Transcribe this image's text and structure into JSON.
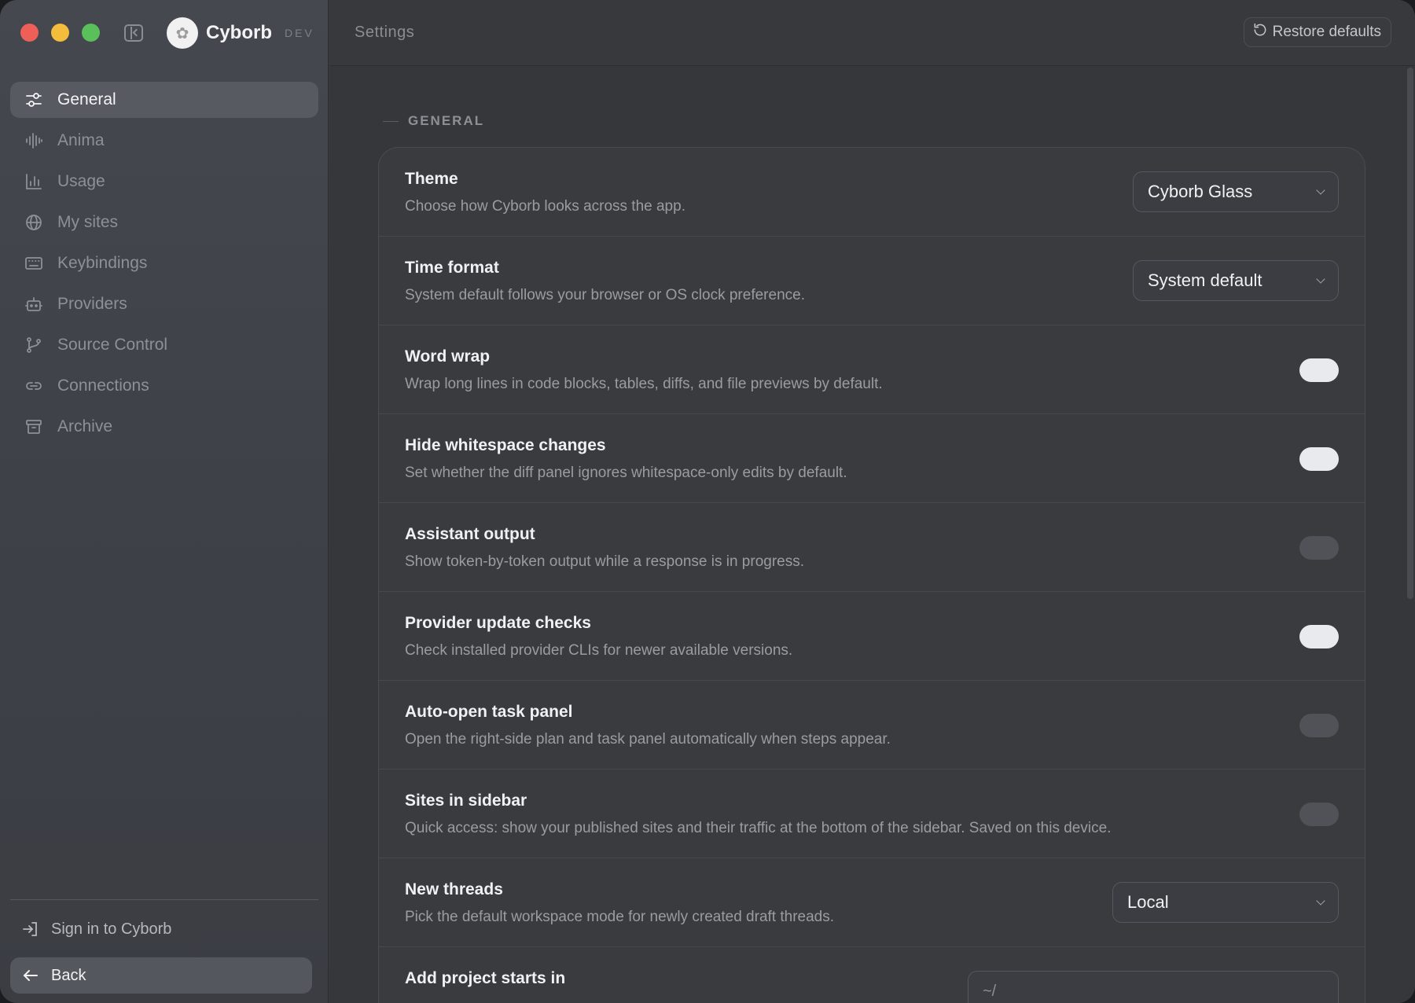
{
  "window": {
    "brand_name": "Cyborb",
    "brand_badge": "DEV"
  },
  "sidebar": {
    "items": [
      {
        "label": "General",
        "icon": "sliders-icon",
        "active": true
      },
      {
        "label": "Anima",
        "icon": "waveform-icon"
      },
      {
        "label": "Usage",
        "icon": "bar-chart-icon"
      },
      {
        "label": "My sites",
        "icon": "globe-icon"
      },
      {
        "label": "Keybindings",
        "icon": "keyboard-icon"
      },
      {
        "label": "Providers",
        "icon": "robot-icon"
      },
      {
        "label": "Source Control",
        "icon": "git-branch-icon"
      },
      {
        "label": "Connections",
        "icon": "link-icon"
      },
      {
        "label": "Archive",
        "icon": "archive-icon"
      }
    ],
    "sign_in_label": "Sign in to Cyborb",
    "back_label": "Back"
  },
  "topbar": {
    "title": "Settings",
    "restore_label": "Restore defaults"
  },
  "section": {
    "label": "GENERAL"
  },
  "settings": [
    {
      "title": "Theme",
      "description": "Choose how Cyborb looks across the app.",
      "control": "select",
      "value": "Cyborb Glass"
    },
    {
      "title": "Time format",
      "description": "System default follows your browser or OS clock preference.",
      "control": "select",
      "value": "System default"
    },
    {
      "title": "Word wrap",
      "description": "Wrap long lines in code blocks, tables, diffs, and file previews by default.",
      "control": "toggle",
      "on": true
    },
    {
      "title": "Hide whitespace changes",
      "description": "Set whether the diff panel ignores whitespace-only edits by default.",
      "control": "toggle",
      "on": true
    },
    {
      "title": "Assistant output",
      "description": "Show token-by-token output while a response is in progress.",
      "control": "toggle",
      "on": false
    },
    {
      "title": "Provider update checks",
      "description": "Check installed provider CLIs for newer available versions.",
      "control": "toggle",
      "on": true
    },
    {
      "title": "Auto-open task panel",
      "description": "Open the right-side plan and task panel automatically when steps appear.",
      "control": "toggle",
      "on": false
    },
    {
      "title": "Sites in sidebar",
      "description": "Quick access: show your published sites and their traffic at the bottom of the sidebar. Saved on this device.",
      "control": "toggle",
      "on": false
    },
    {
      "title": "New threads",
      "description": "Pick the default workspace mode for newly created draft threads.",
      "control": "select",
      "value": "Local"
    },
    {
      "title": "Add project starts in",
      "description": "",
      "control": "input",
      "placeholder": "~/"
    }
  ],
  "colors": {
    "accent_on": "#e9eaee",
    "toggle_off": "#505258",
    "close": "#ee5f57",
    "minimize": "#f4bd3b",
    "zoom": "#5ac05a"
  }
}
